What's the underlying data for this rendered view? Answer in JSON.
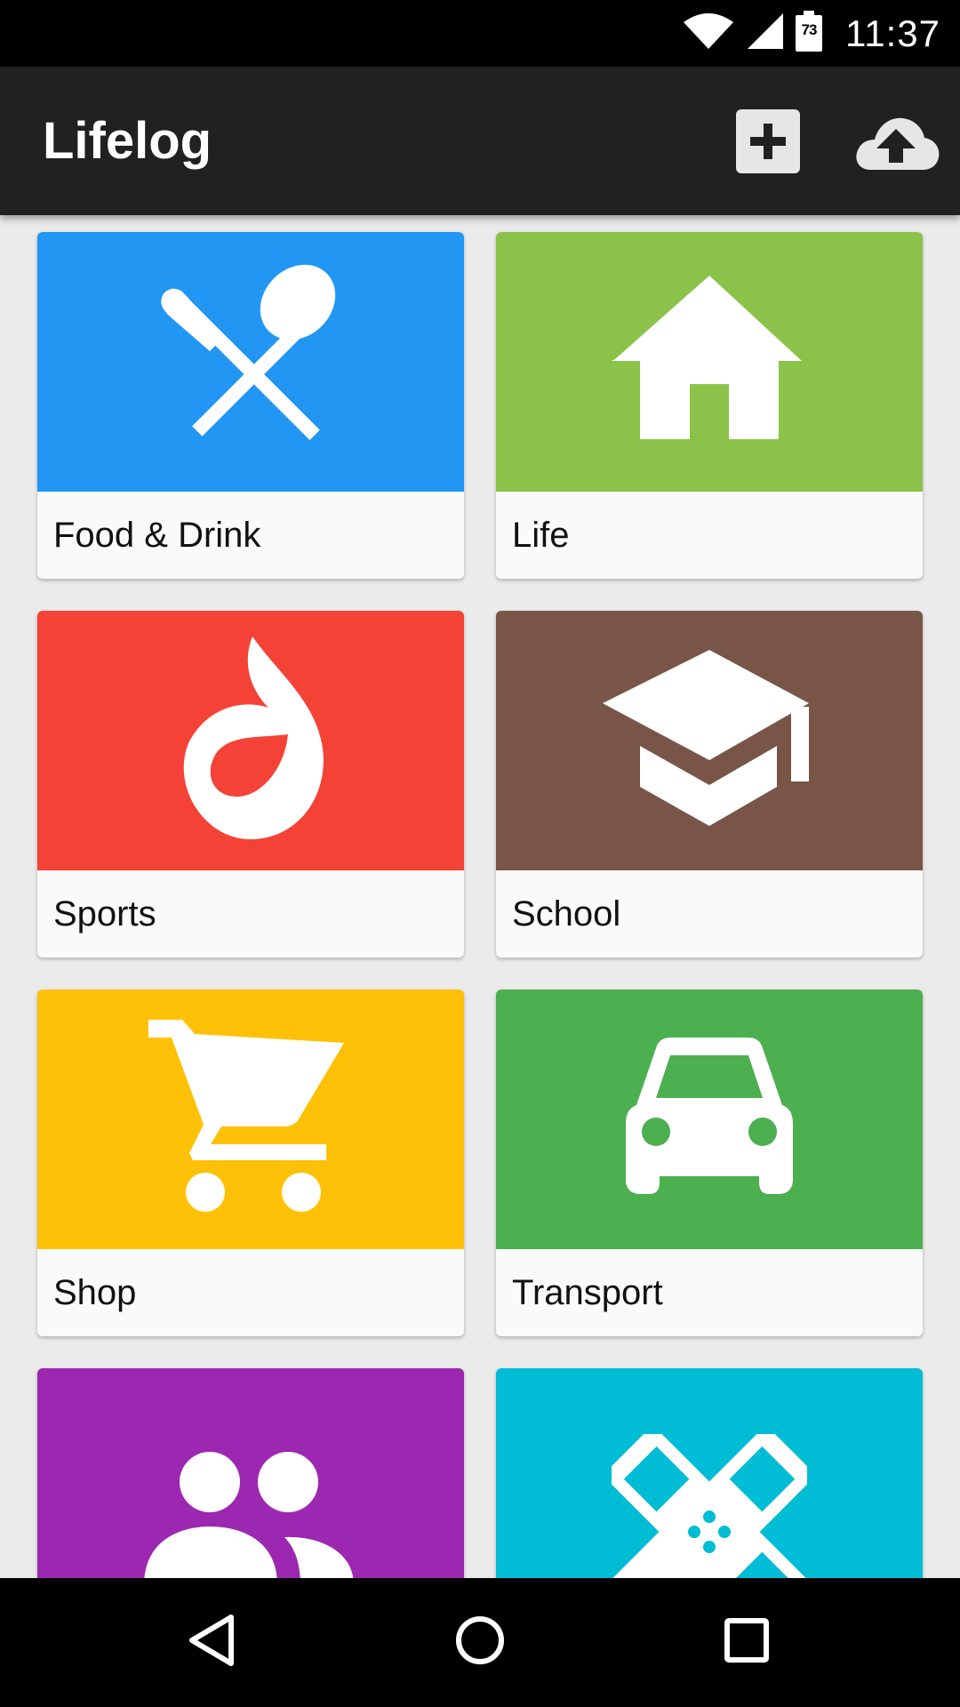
{
  "status_bar": {
    "time": "11:37",
    "battery_level": "73",
    "icons": [
      "wifi-icon",
      "cell-signal-icon",
      "battery-icon"
    ]
  },
  "app_bar": {
    "title": "Lifelog",
    "actions": [
      "add-icon",
      "cloud-upload-icon"
    ]
  },
  "categories": [
    {
      "label": "Food & Drink",
      "icon": "fork-spoon-icon",
      "color": "#2196F3"
    },
    {
      "label": "Life",
      "icon": "house-icon",
      "color": "#8BC34A"
    },
    {
      "label": "Sports",
      "icon": "flame-icon",
      "color": "#F44336"
    },
    {
      "label": "School",
      "icon": "graduation-cap-icon",
      "color": "#795548"
    },
    {
      "label": "Shop",
      "icon": "shopping-cart-icon",
      "color": "#FFC107"
    },
    {
      "label": "Transport",
      "icon": "car-icon",
      "color": "#4CAF50"
    },
    {
      "label": "",
      "icon": "people-icon",
      "color": "#9C27B0"
    },
    {
      "label": "",
      "icon": "bandage-icon",
      "color": "#00BCD4"
    }
  ],
  "nav_bar": {
    "buttons": [
      "back-icon",
      "home-icon",
      "recents-icon"
    ]
  }
}
